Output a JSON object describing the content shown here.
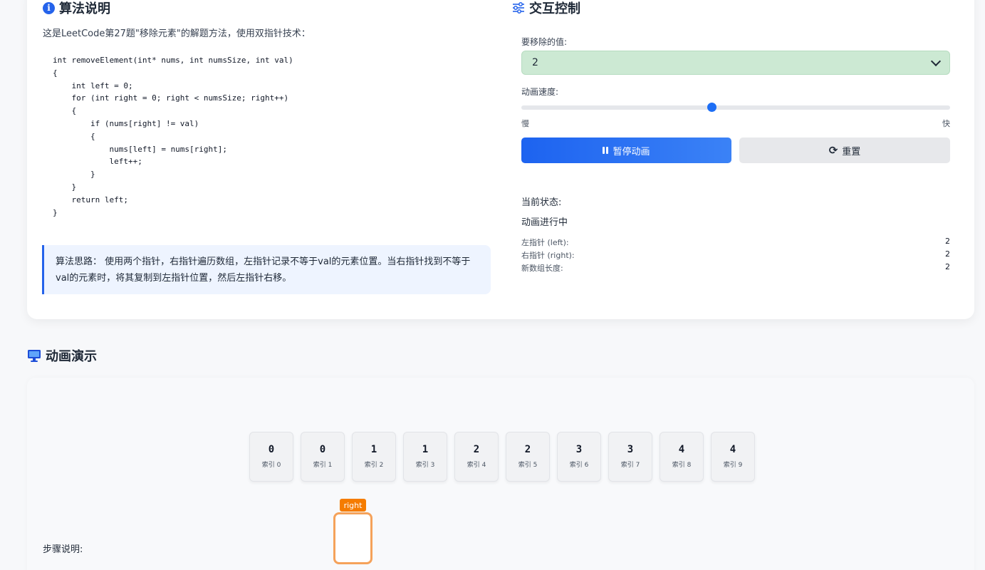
{
  "algorithm": {
    "title": "算法说明",
    "description": "这是LeetCode第27题\"移除元素\"的解题方法，使用双指针技术：",
    "code": "int removeElement(int* nums, int numsSize, int val)\n{\n    int left = 0;\n    for (int right = 0; right < numsSize; right++)\n    {\n        if (nums[right] != val)\n        {\n            nums[left] = nums[right];\n            left++;\n        }\n    }\n    return left;\n}",
    "note": "算法思路： 使用两个指针，右指针遍历数组，左指针记录不等于val的元素位置。当右指针找到不等于val的元素时，将其复制到左指针位置，然后左指针右移。"
  },
  "controls": {
    "title": "交互控制",
    "remove_value_label": "要移除的值:",
    "remove_value": "2",
    "speed_label": "动画速度:",
    "speed_value": 0.444,
    "slow_label": "慢",
    "fast_label": "快",
    "pause_label": "暂停动画",
    "reset_label": "重置"
  },
  "status": {
    "title": "当前状态:",
    "text": "动画进行中",
    "rows": [
      {
        "label": "左指针 (left):",
        "value": "2"
      },
      {
        "label": "右指针 (right):",
        "value": "2"
      },
      {
        "label": "新数组长度:",
        "value": "2"
      }
    ]
  },
  "demo": {
    "title": "动画演示",
    "cells": [
      {
        "value": "0",
        "index": "索引 0"
      },
      {
        "value": "0",
        "index": "索引 1"
      },
      {
        "value": "1",
        "index": "索引 2"
      },
      {
        "value": "1",
        "index": "索引 3"
      },
      {
        "value": "2",
        "index": "索引 4"
      },
      {
        "value": "2",
        "index": "索引 5"
      },
      {
        "value": "3",
        "index": "索引 6"
      },
      {
        "value": "3",
        "index": "索引 7"
      },
      {
        "value": "4",
        "index": "索引 8"
      },
      {
        "value": "4",
        "index": "索引 9"
      }
    ],
    "pointer_label": "right",
    "step_label": "步骤说明:"
  },
  "colors": {
    "accent": "#1d63f0",
    "select_bg": "#cce9d3",
    "pointer": "#f57c00"
  },
  "icons": {
    "algorithm": "info-circle-icon",
    "controls": "sliders-icon",
    "demo": "monitor-icon",
    "pause": "pause-icon",
    "reset": "sync-icon"
  }
}
